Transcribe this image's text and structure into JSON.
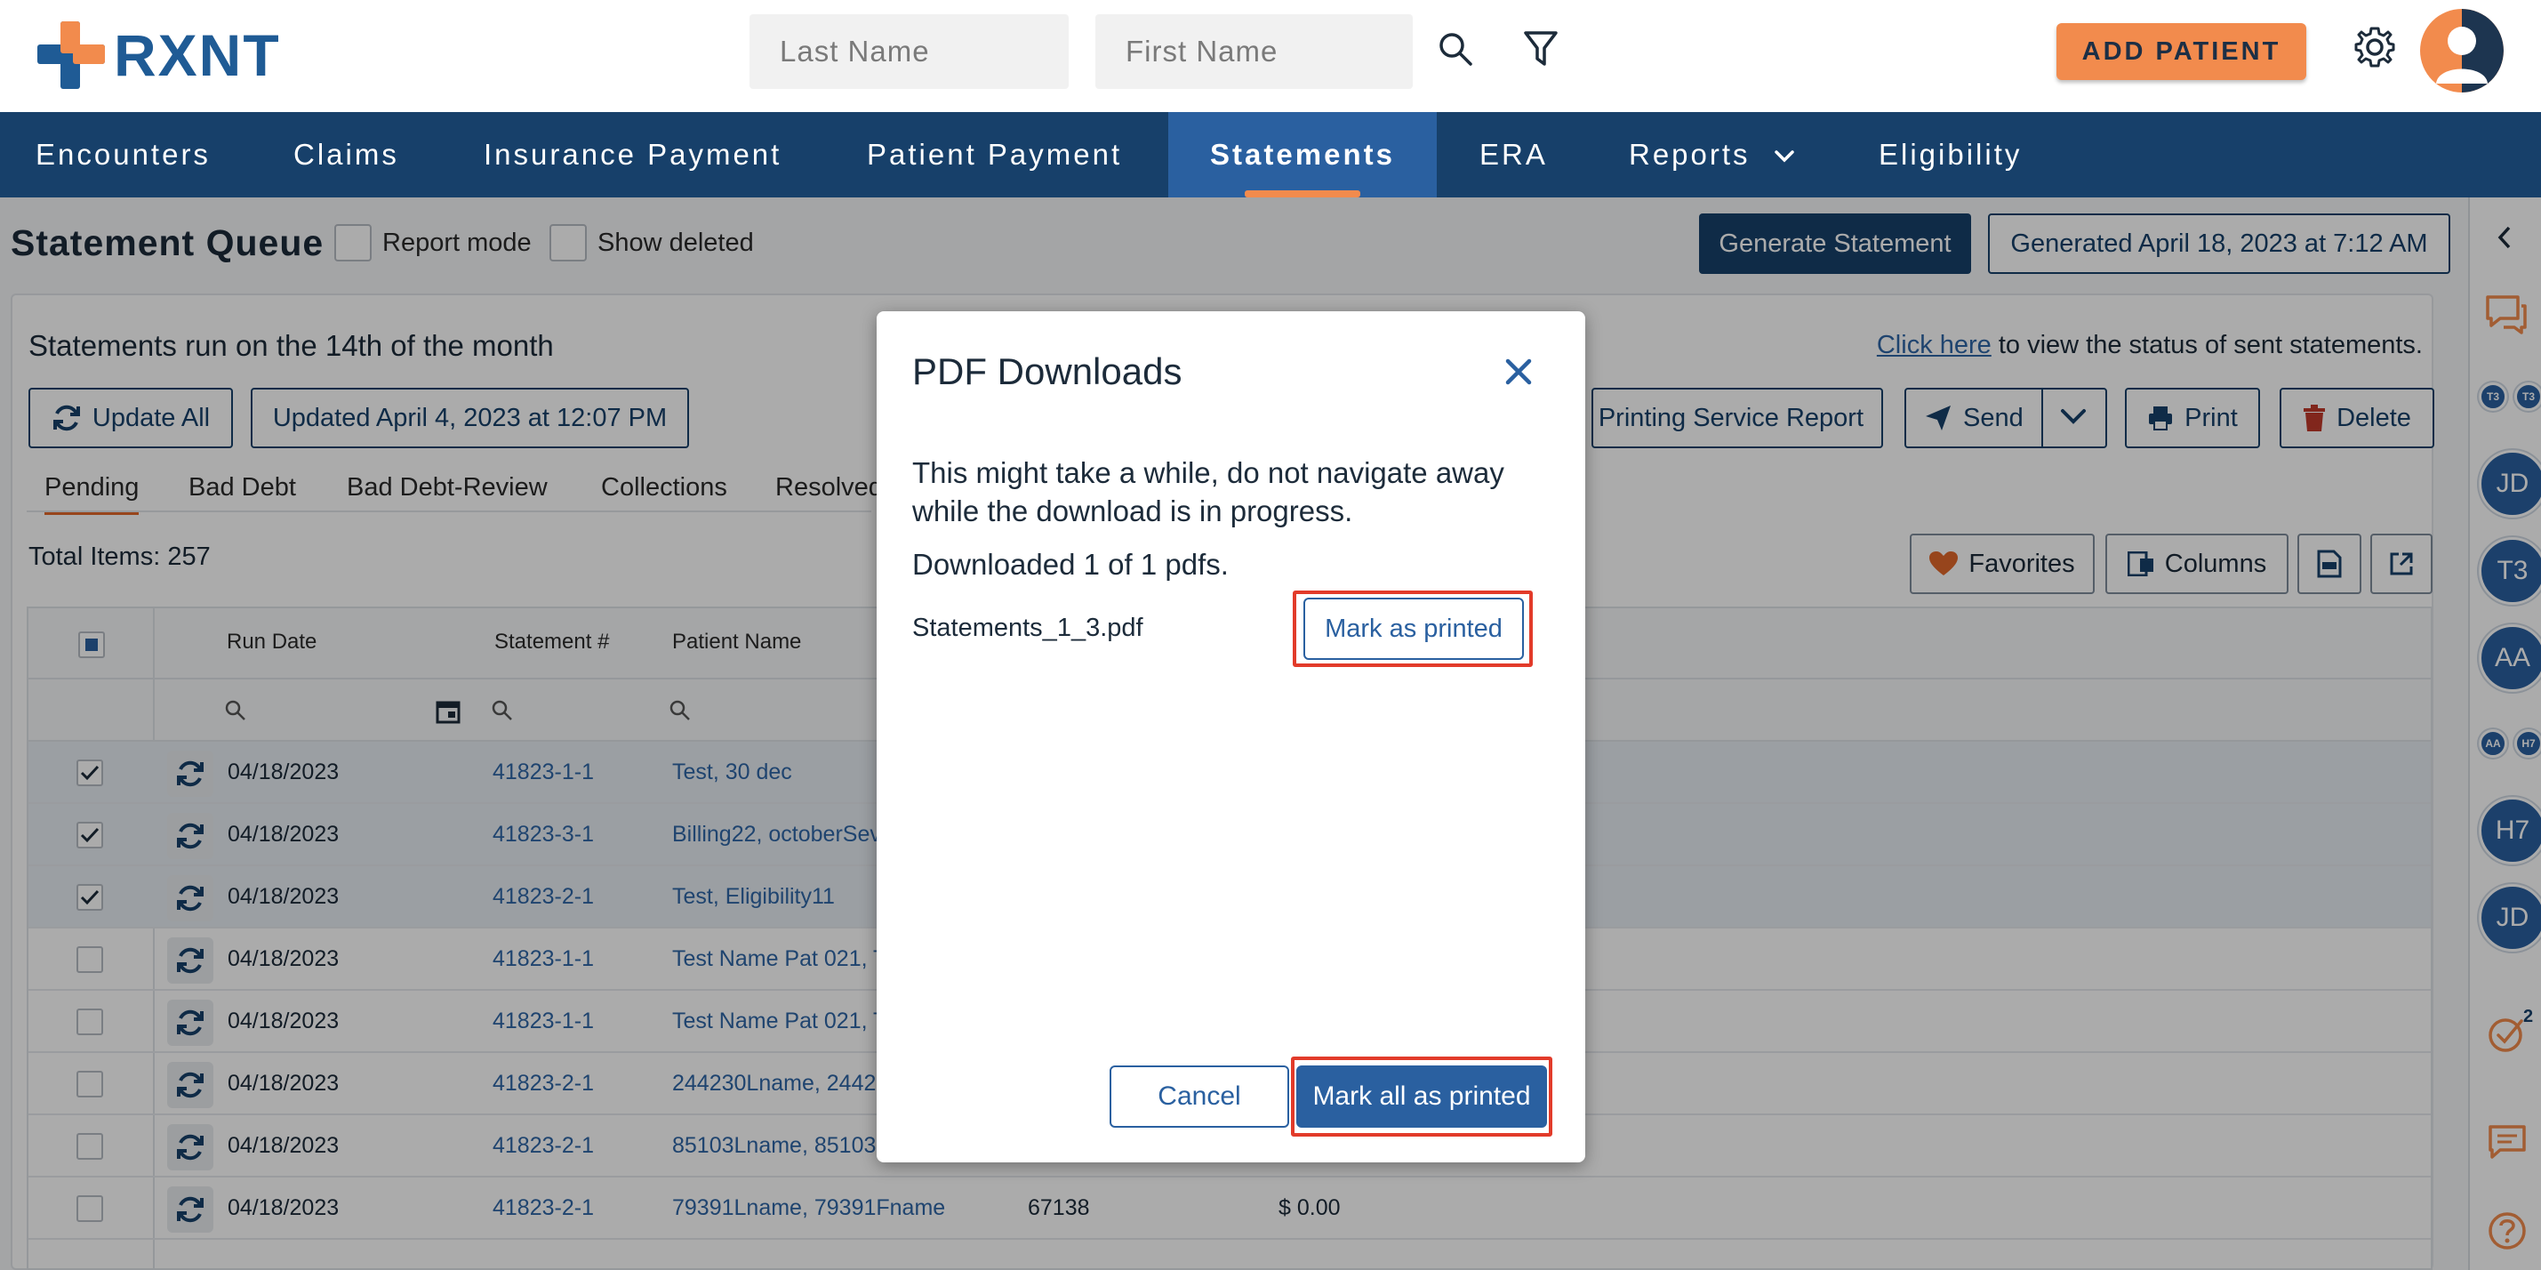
{
  "header": {
    "logo_text": "RXNT",
    "last_name_placeholder": "Last Name",
    "first_name_placeholder": "First Name",
    "add_patient_label": "ADD PATIENT"
  },
  "nav": {
    "items": [
      {
        "label": "Encounters"
      },
      {
        "label": "Claims"
      },
      {
        "label": "Insurance Payment"
      },
      {
        "label": "Patient Payment"
      },
      {
        "label": "Statements",
        "active": true
      },
      {
        "label": "ERA"
      },
      {
        "label": "Reports"
      },
      {
        "label": "Eligibility"
      }
    ]
  },
  "page": {
    "title": "Statement Queue",
    "report_mode_label": "Report mode",
    "show_deleted_label": "Show deleted",
    "generate_label": "Generate Statement",
    "generated_label": "Generated April 18, 2023 at 7:12 AM",
    "run_note": "Statements run on the 14th of the month",
    "status_link": "Click here",
    "status_suffix": "to view the status of sent statements.",
    "update_all_label": "Update All",
    "updated_label": "Updated April 4, 2023 at 12:07 PM",
    "printing_report_label": "Printing Service Report",
    "send_label": "Send",
    "print_label": "Print",
    "delete_label": "Delete",
    "tabs": [
      "Pending",
      "Bad Debt",
      "Bad Debt-Review",
      "Collections",
      "Resolved"
    ],
    "total_items": "Total Items: 257",
    "favorites_label": "Favorites",
    "columns_label": "Columns"
  },
  "grid": {
    "headers": {
      "run_date": "Run Date",
      "statement": "Statement #",
      "patient": "Patient Name"
    },
    "rows": [
      {
        "checked": true,
        "date": "04/18/2023",
        "statement": "41823-1-1",
        "patient": "Test, 30 dec",
        "extra": "",
        "amount": ""
      },
      {
        "checked": true,
        "date": "04/18/2023",
        "statement": "41823-3-1",
        "patient": "Billing22, octoberSev",
        "extra": "",
        "amount": ""
      },
      {
        "checked": true,
        "date": "04/18/2023",
        "statement": "41823-2-1",
        "patient": "Test, Eligibility11",
        "extra": "",
        "amount": ""
      },
      {
        "checked": false,
        "date": "04/18/2023",
        "statement": "41823-1-1",
        "patient": "Test Name Pat 021, T",
        "extra": "",
        "amount": ""
      },
      {
        "checked": false,
        "date": "04/18/2023",
        "statement": "41823-1-1",
        "patient": "Test Name Pat 021, T",
        "extra": "",
        "amount": ""
      },
      {
        "checked": false,
        "date": "04/18/2023",
        "statement": "41823-2-1",
        "patient": "244230Lname, 2442",
        "extra": "",
        "amount": ""
      },
      {
        "checked": false,
        "date": "04/18/2023",
        "statement": "41823-2-1",
        "patient": "85103Lname, 85103",
        "extra": "",
        "amount": ""
      },
      {
        "checked": false,
        "date": "04/18/2023",
        "statement": "41823-2-1",
        "patient": "79391Lname, 79391Fname",
        "extra": "67138",
        "amount": "$ 0.00"
      }
    ]
  },
  "sidebar": {
    "chips": [
      "T3",
      "T3",
      "JD",
      "T3",
      "AA",
      "AA",
      "H7",
      "H7",
      "JD"
    ],
    "tasks_badge": "2"
  },
  "modal": {
    "title": "PDF Downloads",
    "message": "This might take a while, do not navigate away while the download is in progress.",
    "count": "Downloaded 1 of 1 pdfs.",
    "file_name": "Statements_1_3.pdf",
    "mark_label": "Mark as printed",
    "cancel_label": "Cancel",
    "mark_all_label": "Mark all as printed"
  },
  "colors": {
    "brand": "#17406a",
    "accent": "#f28b4d",
    "highlight": "#e23b2a"
  }
}
